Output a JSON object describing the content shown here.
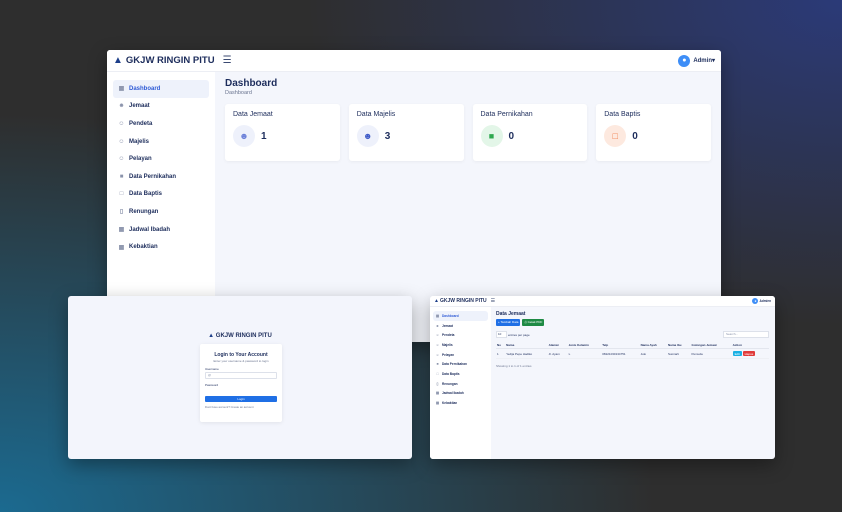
{
  "brand": "GKJW RINGIN PITU",
  "user": {
    "name": "Admin"
  },
  "dashboard": {
    "title": "Dashboard",
    "breadcrumb": "Dashboard",
    "sidebar": [
      {
        "label": "Dashboard",
        "icon": "dashboard-icon"
      },
      {
        "label": "Jemaat",
        "icon": "users-icon"
      },
      {
        "label": "Pendeta",
        "icon": "user-icon"
      },
      {
        "label": "Majelis",
        "icon": "user-icon"
      },
      {
        "label": "Pelayan",
        "icon": "user-icon"
      },
      {
        "label": "Data Pernikahan",
        "icon": "folder-icon"
      },
      {
        "label": "Data Baptis",
        "icon": "folder-icon"
      },
      {
        "label": "Renungan",
        "icon": "book-icon"
      },
      {
        "label": "Jadwal Ibadah",
        "icon": "calendar-icon"
      },
      {
        "label": "Kebaktian",
        "icon": "calendar-icon"
      }
    ],
    "cards": [
      {
        "title": "Data Jemaat",
        "value": "1",
        "icon": "users-outline-icon",
        "bg": "#eef1fb",
        "fg": "#6a7fd8"
      },
      {
        "title": "Data Majelis",
        "value": "3",
        "icon": "users-icon",
        "bg": "#eef1fb",
        "fg": "#3f5bc8"
      },
      {
        "title": "Data Pernikahan",
        "value": "0",
        "icon": "folder-icon",
        "bg": "#e3f6e8",
        "fg": "#2fa84f"
      },
      {
        "title": "Data Baptis",
        "value": "0",
        "icon": "folder-outline-icon",
        "bg": "#fde9df",
        "fg": "#f07a45"
      }
    ]
  },
  "login": {
    "title": "Login to Your Account",
    "subtitle": "Enter your username & password to login",
    "username_label": "Username",
    "username_prefix": "@",
    "password_label": "Password",
    "button": "Login",
    "footer": "Dont have account? Create an account"
  },
  "jemaat": {
    "title": "Data Jemaat",
    "add_button": "+ Tambah Data",
    "pdf_button": "Cetak PDF",
    "per_page_value": "10",
    "per_page_label": "entries per page",
    "search_placeholder": "Search...",
    "columns": [
      "No",
      "Nama",
      "Alamat",
      "Jenis Kelamin",
      "Telp",
      "Nama Ayah",
      "Nama Ibu",
      "Golongan Jemaat",
      "Action"
    ],
    "rows": [
      [
        "1",
        "Yedija Pepe Hadiko",
        "Jl. Ayam",
        "L",
        "08221030134751",
        "Jolo",
        "Sumiarti",
        "Pemuda"
      ]
    ],
    "edit_label": "Edit",
    "delete_label": "Hapus",
    "showing": "Showing 1 to 1 of 1 entries"
  },
  "colors": {
    "primary": "#1f6fe5",
    "success": "#1e8a44",
    "danger": "#e03a3a",
    "info": "#1ab0e3"
  }
}
